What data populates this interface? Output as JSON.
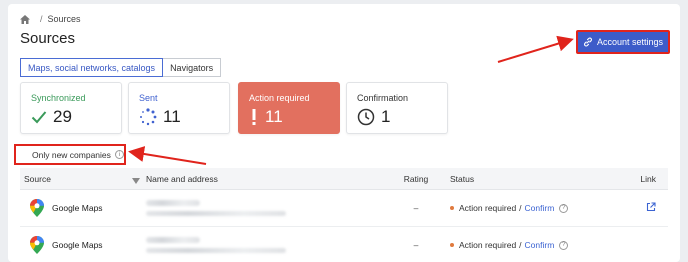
{
  "breadcrumb": {
    "current": "Sources"
  },
  "page_title": "Sources",
  "account_button": {
    "label": "Account settings"
  },
  "tabs": [
    {
      "label": "Maps, social networks, catalogs",
      "active": true
    },
    {
      "label": "Navigators",
      "active": false
    }
  ],
  "cards": {
    "synchronized": {
      "label": "Synchronized",
      "count": "29"
    },
    "sent": {
      "label": "Sent",
      "count": "11"
    },
    "action_required": {
      "label": "Action required",
      "count": "11"
    },
    "confirmation": {
      "label": "Confirmation",
      "count": "1"
    }
  },
  "filter": {
    "only_new_label": "Only new companies"
  },
  "table": {
    "headers": {
      "source": "Source",
      "name": "Name and address",
      "rating": "Rating",
      "status": "Status",
      "link": "Link"
    },
    "rows": [
      {
        "source": "Google Maps",
        "rating": "–",
        "status": "Action required",
        "separator": "/",
        "action": "Confirm"
      },
      {
        "source": "Google Maps",
        "rating": "–",
        "status": "Action required",
        "separator": "/",
        "action": "Confirm"
      }
    ]
  },
  "colors": {
    "accent": "#3d5cc9",
    "action_required": "#e2705f",
    "annotation": "#e0241c",
    "synced": "#3a9a5a"
  }
}
